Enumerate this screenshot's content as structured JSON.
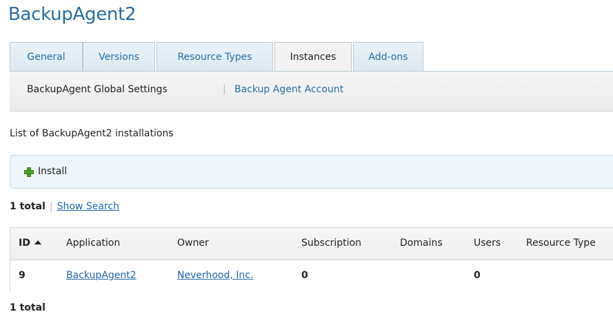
{
  "page": {
    "title": "BackupAgent2"
  },
  "tabs": [
    {
      "label": "General"
    },
    {
      "label": "Versions"
    },
    {
      "label": "Resource Types"
    },
    {
      "label": "Instances"
    },
    {
      "label": "Add-ons"
    }
  ],
  "subnav": {
    "global_settings": "BackupAgent Global Settings",
    "separator": "|",
    "account": "Backup Agent Account"
  },
  "description": "List of BackupAgent2 installations",
  "toolbar": {
    "install_label": "Install",
    "install_icon": "plus-icon"
  },
  "list_summary": {
    "total": "1 total",
    "separator": "|",
    "show_search": "Show Search"
  },
  "table": {
    "headers": [
      "ID",
      "Application",
      "Owner",
      "Subscription",
      "Domains",
      "Users",
      "Resource Type"
    ],
    "sort": {
      "column": "ID",
      "direction": "asc"
    },
    "rows": [
      {
        "id": "9",
        "application": "BackupAgent2",
        "owner": "Neverhood, Inc.",
        "subscription": "0",
        "domains": "",
        "users": "0",
        "resource_type": ""
      }
    ]
  },
  "footer": {
    "total": "1 total"
  },
  "colors": {
    "accent": "#2a6e9e",
    "link": "#2266aa",
    "install_icon": "#4ea02c"
  }
}
